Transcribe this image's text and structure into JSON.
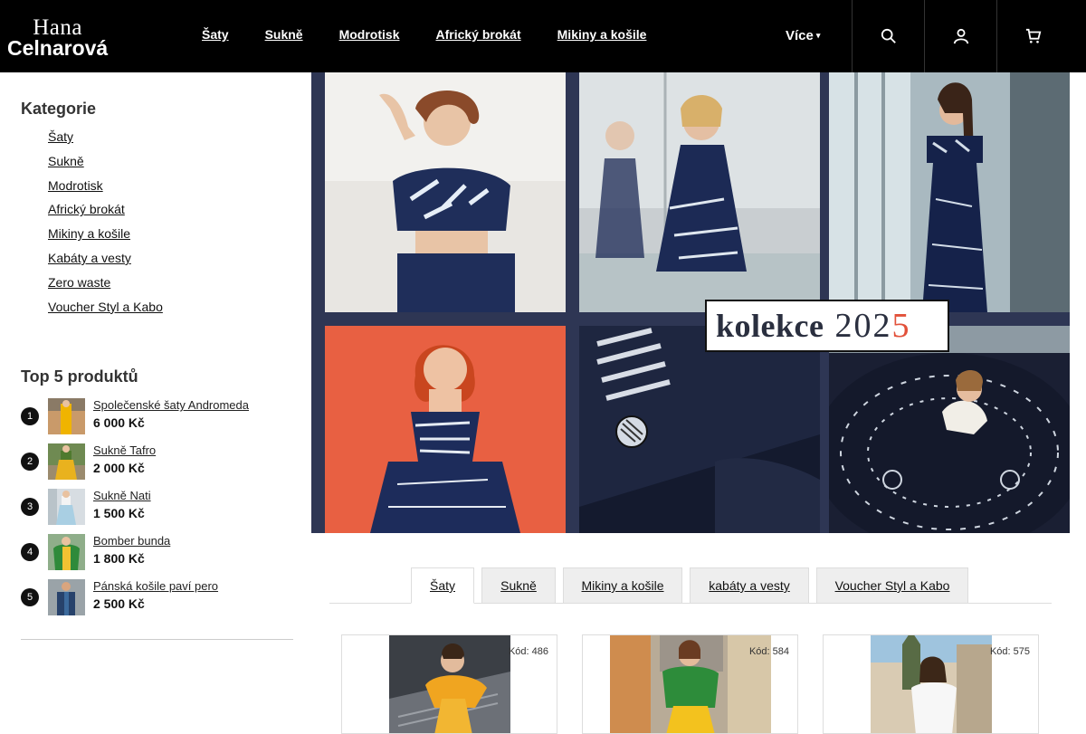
{
  "header": {
    "logo_line1": "Hana",
    "logo_line2": "Celnarová",
    "nav": [
      "Šaty",
      "Sukně",
      "Modrotisk",
      "Africký brokát",
      "Mikiny a košile"
    ],
    "more_label": "Více",
    "icons": [
      "search-icon",
      "user-icon",
      "cart-icon"
    ]
  },
  "sidebar": {
    "categories_title": "Kategorie",
    "categories": [
      "Šaty",
      "Sukně",
      "Modrotisk",
      "Africký brokát",
      "Mikiny a košile",
      "Kabáty a vesty",
      "Zero waste",
      "Voucher Styl a Kabo"
    ],
    "top_title": "Top 5 produktů",
    "top_products": [
      {
        "rank": "1",
        "name": "Společenské šaty Andromeda",
        "price": "6 000 Kč"
      },
      {
        "rank": "2",
        "name": "Sukně Tafro",
        "price": "2 000 Kč"
      },
      {
        "rank": "3",
        "name": "Sukně Nati",
        "price": "1 500 Kč"
      },
      {
        "rank": "4",
        "name": "Bomber bunda",
        "price": "1 800 Kč"
      },
      {
        "rank": "5",
        "name": "Pánská košile paví pero",
        "price": "2 500 Kč"
      }
    ]
  },
  "banner": {
    "word": "kolekce",
    "year_start": "202",
    "year_end": "5"
  },
  "tabs": [
    "Šaty",
    "Sukně",
    "Mikiny a košile",
    "kabáty a vesty",
    "Voucher Styl a Kabo"
  ],
  "active_tab": "Šaty",
  "products": [
    {
      "code": "Kód: 486"
    },
    {
      "code": "Kód: 584"
    },
    {
      "code": "Kód: 575"
    }
  ],
  "colors": {
    "header_bg": "#000000",
    "banner_navy": "#2e3654",
    "accent_red": "#e2513a"
  }
}
